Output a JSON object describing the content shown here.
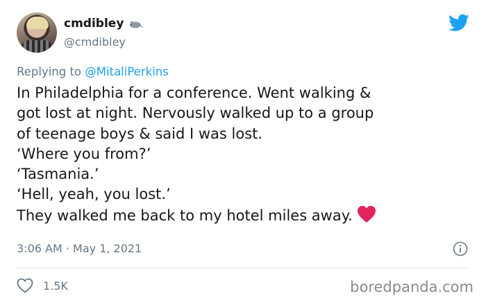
{
  "author": {
    "display_name": "cmdibley",
    "handle": "@cmdibley"
  },
  "reply": {
    "prefix": "Replying to",
    "mention": "@MitaliPerkins"
  },
  "tweet_lines": [
    "In Philadelphia for a conference. Went walking &",
    "got lost at night. Nervously walked up to a group",
    "of teenage boys & said I was lost.",
    "‘Where you from?’",
    "‘Tasmania.’",
    "‘Hell, yeah, you lost.’",
    "They walked me back to my hotel miles away."
  ],
  "timestamp": "3:06 AM · May 1, 2021",
  "likes_count": "1.5K",
  "watermark": "boredpanda.com",
  "icons": {
    "brand": "twitter-bird-icon",
    "name_emoji": "rat-emoji-icon",
    "inline": "red-heart-emoji-icon",
    "info": "info-icon",
    "like": "heart-outline-icon"
  },
  "colors": {
    "twitter_blue": "#1da1f2",
    "muted_text": "#657786",
    "heart_red": "#e0245e"
  }
}
